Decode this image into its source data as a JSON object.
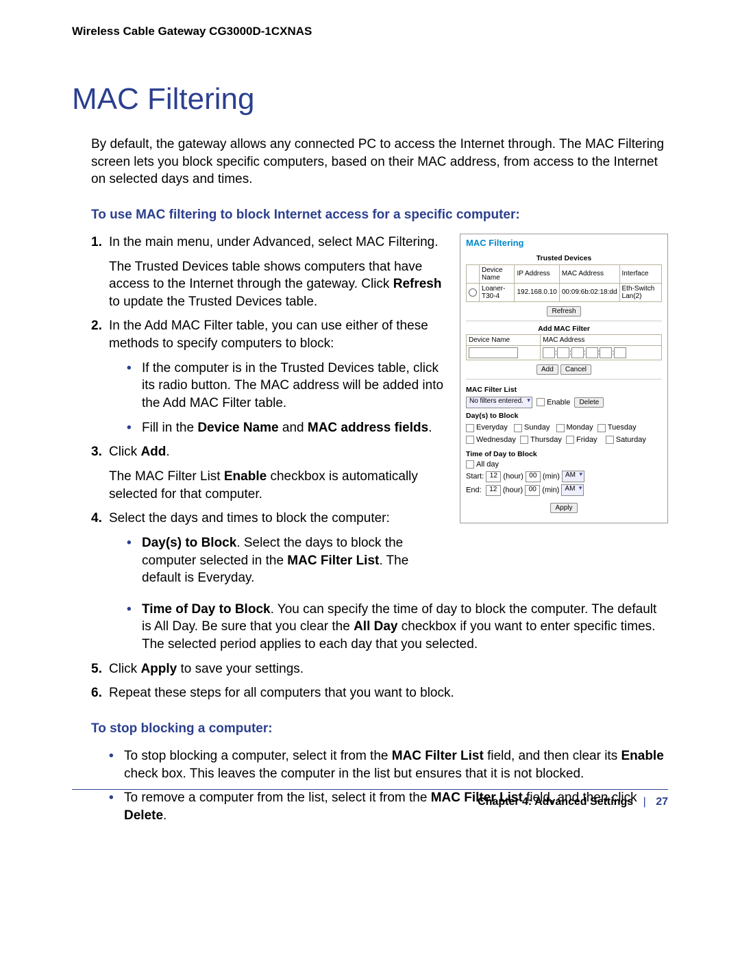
{
  "header": {
    "product": "Wireless Cable Gateway CG3000D-1CXNAS"
  },
  "title": "MAC Filtering",
  "intro": "By default, the gateway allows any connected PC to access the Internet through. The MAC Filtering screen lets you block specific computers, based on their MAC address, from access to the Internet on selected days and times.",
  "subhead1": "To use MAC filtering to block Internet access for a specific computer:",
  "steps": {
    "s1a": "In the main menu, under Advanced, select MAC Filtering.",
    "s1b_a": "The Trusted Devices table shows computers that have access to the Internet through the gateway. Click ",
    "s1b_b": "Refresh",
    "s1b_c": " to update the Trusted Devices table.",
    "s2": "In the Add MAC Filter table, you can use either of these methods to specify computers to block:",
    "s2_b1": "If the computer is in the Trusted Devices table, click its radio button. The MAC address will be added into the Add MAC Filter table.",
    "s2_b2_a": "Fill in the ",
    "s2_b2_b": "Device Name",
    "s2_b2_c": " and ",
    "s2_b2_d": "MAC address fields",
    "s2_b2_e": ".",
    "s3_a": "Click ",
    "s3_b": "Add",
    "s3_c": ".",
    "s3_p_a": "The MAC Filter List ",
    "s3_p_b": "Enable",
    "s3_p_c": " checkbox is automatically selected for that computer.",
    "s4": "Select the days and times to block the computer:",
    "s4_b1_a": "Day(s) to Block",
    "s4_b1_b": ". Select the days to block the computer selected in the ",
    "s4_b1_c": "MAC Filter List",
    "s4_b1_d": ". The default is Everyday.",
    "s4_b2_a": "Time of Day to Block",
    "s4_b2_b": ". You can specify the time of day to block the computer. The default is All Day. Be sure that you clear the ",
    "s4_b2_c": "All Day",
    "s4_b2_d": " checkbox if you want to enter specific times. The selected period applies to each day that you selected.",
    "s5_a": "Click ",
    "s5_b": "Apply",
    "s5_c": " to save your settings.",
    "s6": "Repeat these steps for all computers that you want to block."
  },
  "subhead2": "To stop blocking a computer:",
  "stop": {
    "b1_a": "To stop blocking a computer, select it from the ",
    "b1_b": "MAC Filter List",
    "b1_c": " field, and then clear its ",
    "b1_d": "Enable",
    "b1_e": " check box. This leaves the computer in the list but ensures that it is not blocked.",
    "b2_a": "To remove a computer from the list, select it from the ",
    "b2_b": "MAC Filter List",
    "b2_c": " field, and then click ",
    "b2_d": "Delete",
    "b2_e": "."
  },
  "shot": {
    "title": "MAC Filtering",
    "trusted_title": "Trusted Devices",
    "th_dev": "Device Name",
    "th_ip": "IP Address",
    "th_mac": "MAC Address",
    "th_if": "Interface",
    "row_dev": "Loaner-T30-4",
    "row_ip": "192.168.0.10",
    "row_mac": "00:09:6b:02:18:dd",
    "row_if": "Eth-Switch Lan(2)",
    "refresh": "Refresh",
    "addmac_title": "Add MAC Filter",
    "addmac_dev": "Device Name",
    "addmac_mac": "MAC Address",
    "add": "Add",
    "cancel": "Cancel",
    "list_title": "MAC Filter List",
    "list_sel": "No filters entered.",
    "enable": "Enable",
    "delete": "Delete",
    "days_title": "Day(s) to Block",
    "d_every": "Everyday",
    "d_sun": "Sunday",
    "d_mon": "Monday",
    "d_tue": "Tuesday",
    "d_wed": "Wednesday",
    "d_thu": "Thursday",
    "d_fri": "Friday",
    "d_sat": "Saturday",
    "time_title": "Time of Day to Block",
    "allday": "All day",
    "start": "Start:",
    "end": "End:",
    "h12": "12",
    "m00": "00",
    "hour": "(hour)",
    "min": "(min)",
    "am": "AM",
    "apply": "Apply"
  },
  "footer": {
    "chapter": "Chapter 4:  Advanced Settings",
    "sep": "|",
    "page": "27"
  },
  "nums": {
    "n1": "1.",
    "n2": "2.",
    "n3": "3.",
    "n4": "4.",
    "n5": "5.",
    "n6": "6.",
    "dot": "•"
  }
}
